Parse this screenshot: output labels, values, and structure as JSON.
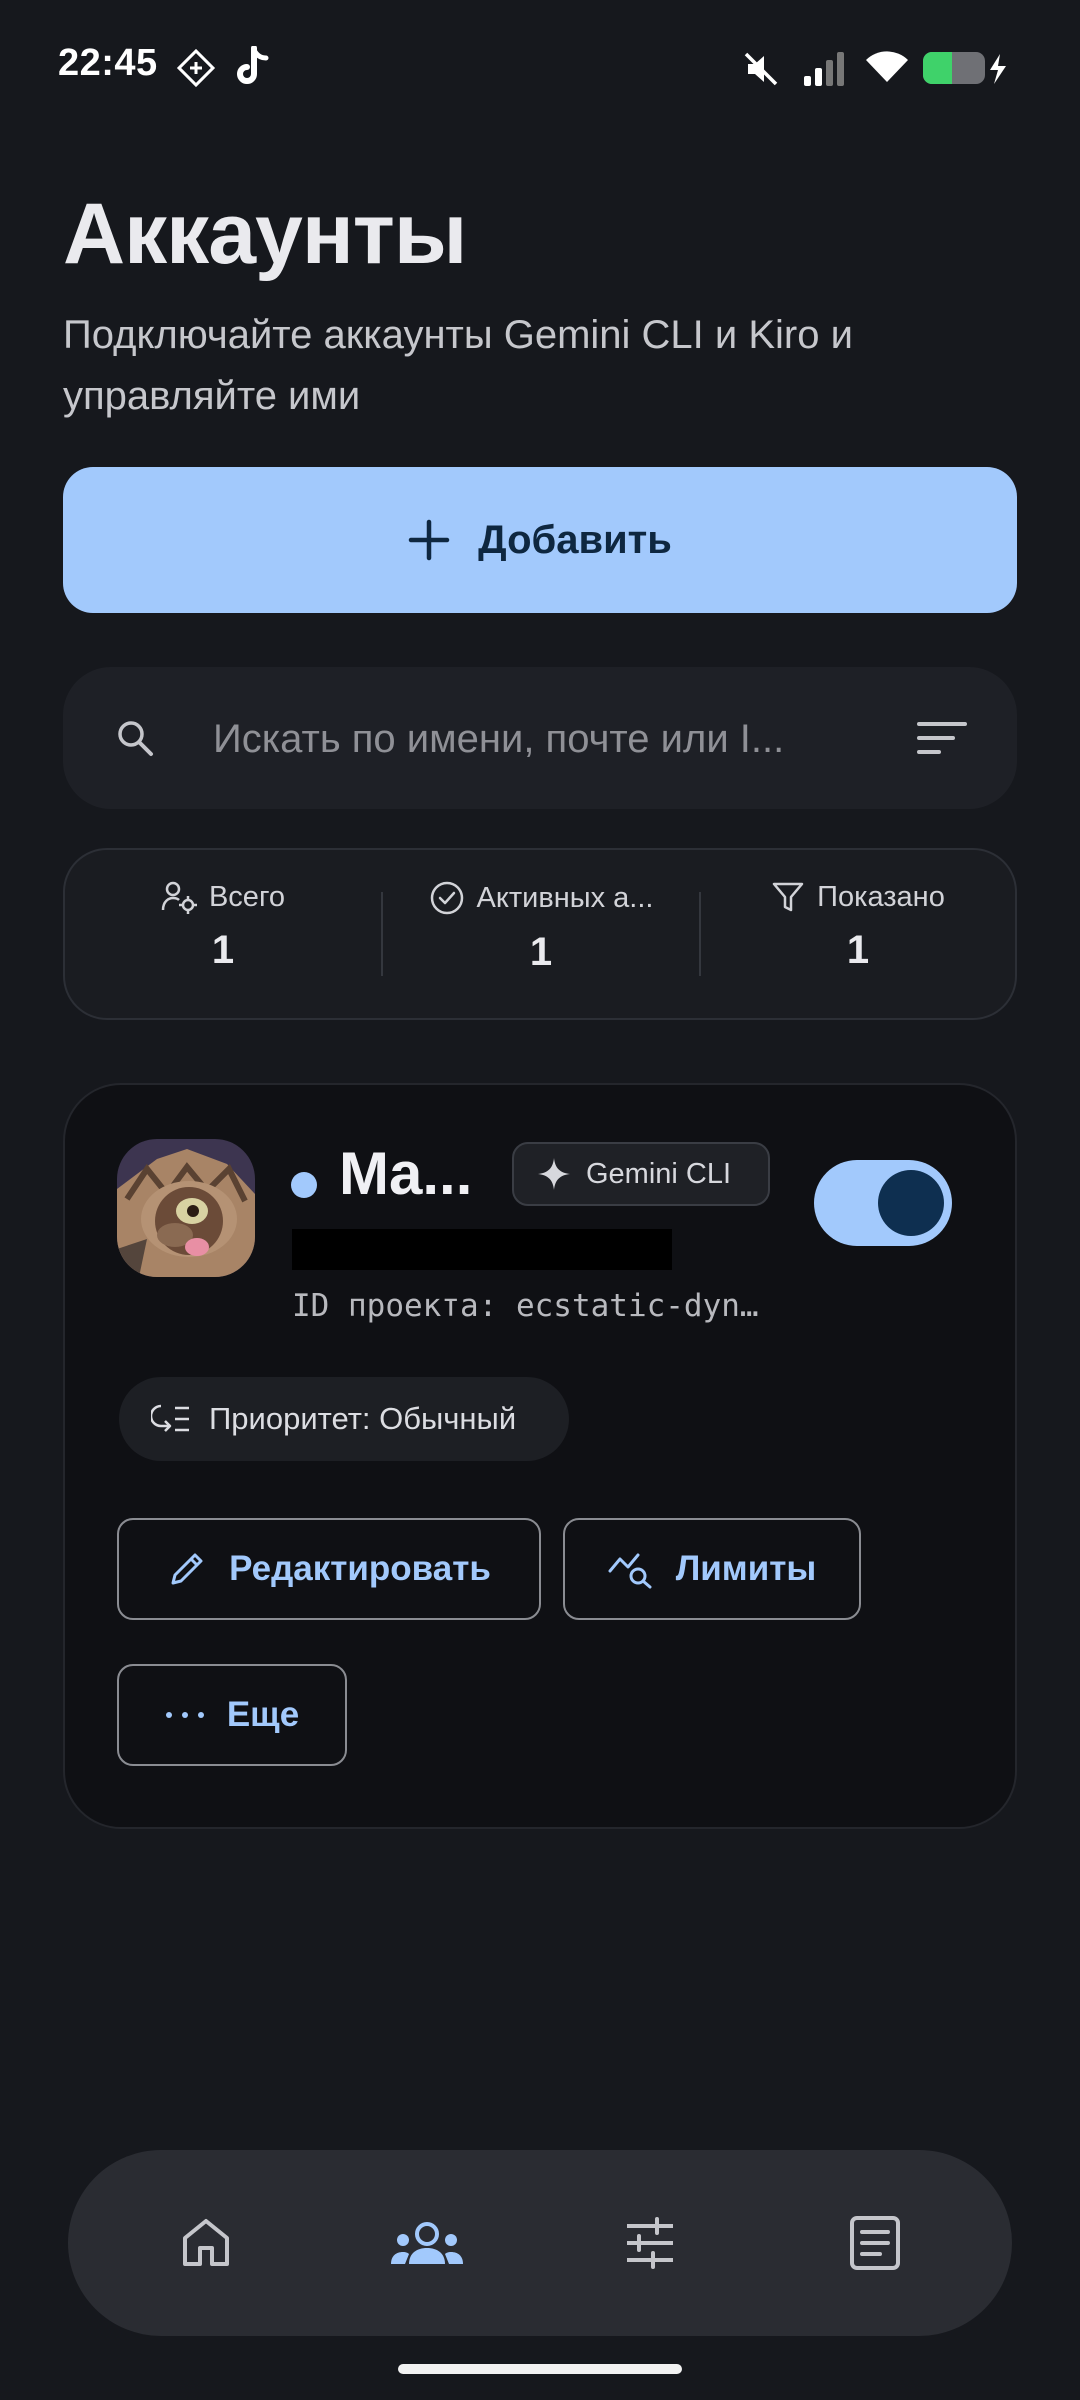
{
  "status_bar": {
    "time": "22:45"
  },
  "header": {
    "title": "Аккаунты",
    "subtitle": "Подключайте аккаунты Gemini CLI и Kiro и управляйте ими"
  },
  "add_button": {
    "label": "Добавить"
  },
  "search": {
    "placeholder": "Искать по имени, почте или I..."
  },
  "stats": [
    {
      "label": "Всего",
      "value": "1",
      "icon": "users-gear-icon"
    },
    {
      "label": "Активных а...",
      "value": "1",
      "icon": "check-circle-icon"
    },
    {
      "label": "Показано",
      "value": "1",
      "icon": "filter-icon"
    }
  ],
  "account": {
    "name": "Ma...",
    "provider": "Gemini CLI",
    "project_id": "ID проекта: ecstatic-dyn…",
    "priority": "Приоритет: Обычный",
    "enabled": true,
    "actions": {
      "edit": "Редактировать",
      "limits": "Лимиты",
      "more": "Еще"
    }
  },
  "bottom_nav": [
    {
      "icon": "home-icon",
      "active": false
    },
    {
      "icon": "accounts-icon",
      "active": true
    },
    {
      "icon": "settings-sliders-icon",
      "active": false
    },
    {
      "icon": "logs-document-icon",
      "active": false
    }
  ],
  "colors": {
    "background": "#16181d",
    "accent": "#a2c9fc",
    "card": "#0f1014"
  }
}
